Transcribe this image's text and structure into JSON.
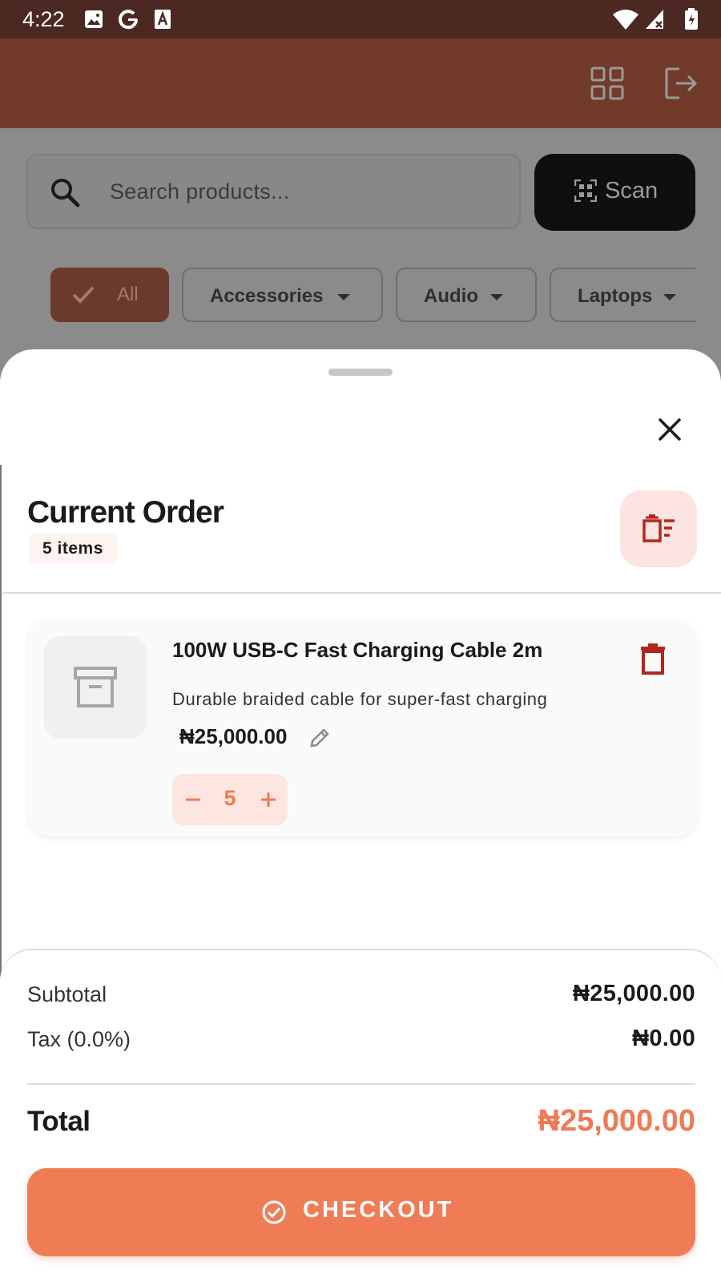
{
  "status_bar": {
    "time": "4:22"
  },
  "search": {
    "placeholder": "Search products..."
  },
  "scan_button": {
    "label": "Scan"
  },
  "categories": [
    {
      "label": "All",
      "selected": true
    },
    {
      "label": "Accessories",
      "selected": false
    },
    {
      "label": "Audio",
      "selected": false
    },
    {
      "label": "Laptops",
      "selected": false
    }
  ],
  "order": {
    "title": "Current Order",
    "item_count": "5 items",
    "items": [
      {
        "name": "100W USB-C Fast Charging Cable 2m",
        "description": "Durable braided cable for super-fast charging",
        "price": "₦25,000.00",
        "quantity": "5"
      }
    ]
  },
  "summary": {
    "subtotal_label": "Subtotal",
    "subtotal_value": "₦25,000.00",
    "tax_label": "Tax (0.0%)",
    "tax_value": "₦0.00",
    "total_label": "Total",
    "total_value": "₦25,000.00"
  },
  "checkout": {
    "label": "CHECKOUT"
  },
  "colors": {
    "status_bar": "#4b2821",
    "app_bar": "#723a28",
    "accent": "#f07c55",
    "delete_red": "#b3261e"
  }
}
